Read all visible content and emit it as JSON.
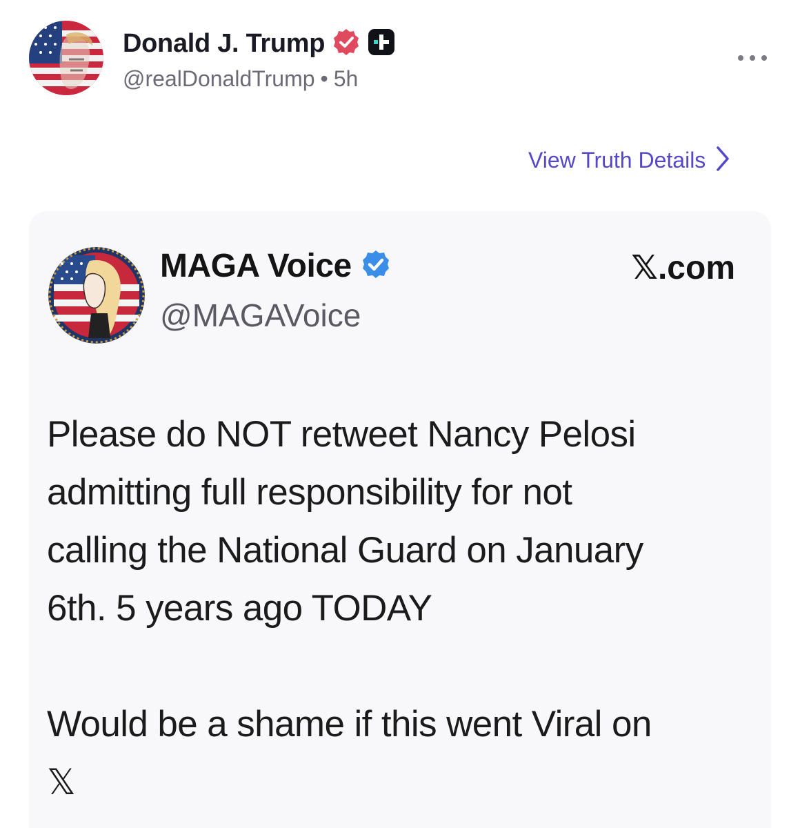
{
  "post": {
    "author_name": "Donald J. Trump",
    "author_handle": "@realDonaldTrump",
    "separator": "•",
    "time_ago": "5h",
    "view_details_label": "View Truth Details"
  },
  "embed": {
    "name": "MAGA Voice",
    "handle": "@MAGAVoice",
    "source": "𝕏.com",
    "body_lines": [
      "Please do NOT retweet Nancy Pelosi",
      "admitting full responsibility for not",
      "calling the National Guard on January",
      "6th. 5 years ago TODAY"
    ],
    "body_para2": "Would be a shame if this went Viral on",
    "body_tail": "𝕏"
  },
  "colors": {
    "accent": "#5448c8",
    "verified_badge_red": "#e04a5f",
    "verified_badge_blue": "#3b8ee8",
    "handle_gray": "#6b6b78",
    "card_bg": "#f8f8fa"
  },
  "icons": [
    "verified-badge-icon",
    "truth-plus-icon",
    "more-options-icon",
    "chevron-right-icon",
    "verified-check-icon"
  ]
}
